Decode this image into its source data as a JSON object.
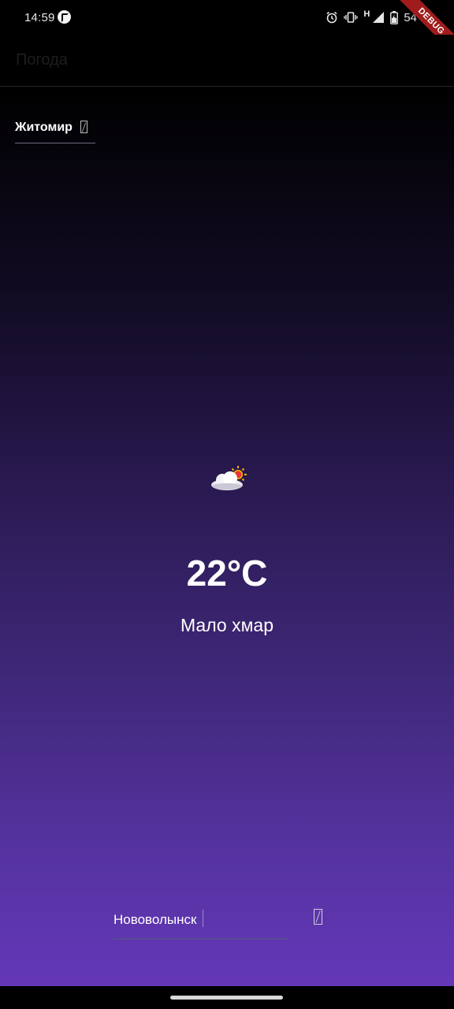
{
  "status_bar": {
    "time": "14:59",
    "network_label": "H",
    "battery_percent": "54",
    "icons": [
      "app-notification-icon",
      "alarm-icon",
      "vibrate-icon",
      "signal-icon",
      "battery-icon"
    ]
  },
  "debug_banner": "DEBUG",
  "app_bar": {
    "title": "Погода"
  },
  "city_selector": {
    "selected": "Житомир",
    "icon": "dropdown-icon"
  },
  "weather": {
    "icon": "cloud-sun-icon",
    "temperature": "22°C",
    "condition": "Мало хмар"
  },
  "city_input": {
    "value": "Нововолынск",
    "icon": "search-icon"
  },
  "colors": {
    "gradient_top": "#000000",
    "gradient_bottom": "#6437b8",
    "accent": "#5a4b90",
    "debug_banner": "#a01c1c"
  }
}
